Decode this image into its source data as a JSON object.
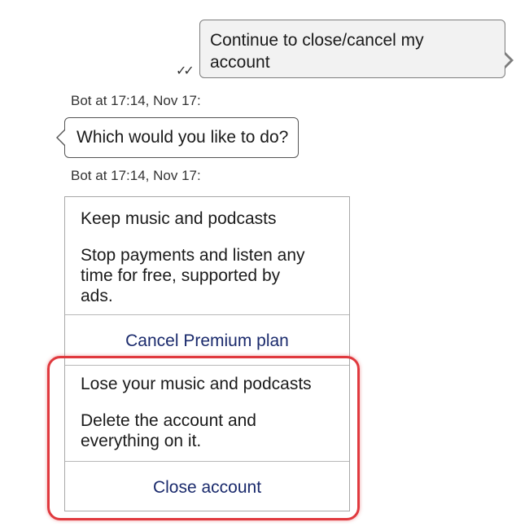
{
  "conversation": {
    "user_message": {
      "line1": "Continue to close/cancel my",
      "line2": "account",
      "status_icon": "double-check-icon"
    },
    "bot_meta_1": "Bot at 17:14, Nov 17:",
    "bot_message": "Which would you like to do?",
    "bot_meta_2": "Bot at 17:14, Nov 17:"
  },
  "options": [
    {
      "title": "Keep music and podcasts",
      "description_lines": [
        "Stop payments and listen any",
        "time for free, supported by",
        "ads."
      ],
      "action": "Cancel Premium plan"
    },
    {
      "title": "Lose your music and podcasts",
      "description_lines": [
        "Delete the account and",
        "everything on it."
      ],
      "action": "Close account"
    }
  ],
  "colors": {
    "highlight": "#e0393e",
    "action_text": "#1a2a6c",
    "user_bubble_bg": "#f2f2f2"
  }
}
